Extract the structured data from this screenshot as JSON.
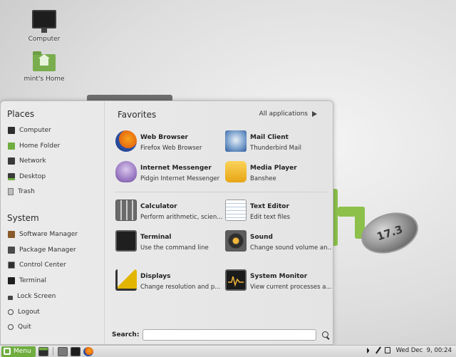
{
  "desktop": {
    "icons": [
      {
        "label": "Computer",
        "icon": "computer-icon"
      },
      {
        "label": "mint's Home",
        "icon": "home-folder-icon"
      }
    ],
    "wallpaper_badge": "17.3"
  },
  "menu": {
    "places": {
      "title": "Places",
      "items": [
        {
          "label": "Computer",
          "icon": "computer-icon"
        },
        {
          "label": "Home Folder",
          "icon": "home-folder-icon"
        },
        {
          "label": "Network",
          "icon": "network-icon"
        },
        {
          "label": "Desktop",
          "icon": "desktop-icon"
        },
        {
          "label": "Trash",
          "icon": "trash-icon"
        }
      ]
    },
    "system": {
      "title": "System",
      "items": [
        {
          "label": "Software Manager",
          "icon": "software-manager-icon"
        },
        {
          "label": "Package Manager",
          "icon": "package-manager-icon"
        },
        {
          "label": "Control Center",
          "icon": "control-center-icon"
        },
        {
          "label": "Terminal",
          "icon": "terminal-icon"
        },
        {
          "label": "Lock Screen",
          "icon": "lock-icon"
        },
        {
          "label": "Logout",
          "icon": "logout-icon"
        },
        {
          "label": "Quit",
          "icon": "quit-icon"
        }
      ]
    },
    "favorites": {
      "title": "Favorites",
      "all_applications": "All applications",
      "apps": [
        {
          "name": "Web Browser",
          "desc": "Firefox Web Browser",
          "icon": "firefox-icon"
        },
        {
          "name": "Mail Client",
          "desc": "Thunderbird Mail",
          "icon": "thunderbird-icon"
        },
        {
          "name": "Internet Messenger",
          "desc": "Pidgin Internet Messenger",
          "icon": "pidgin-icon"
        },
        {
          "name": "Media Player",
          "desc": "Banshee",
          "icon": "banshee-icon"
        },
        {
          "name": "Calculator",
          "desc": "Perform arithmetic, scien...",
          "icon": "calculator-icon"
        },
        {
          "name": "Text Editor",
          "desc": "Edit text files",
          "icon": "text-editor-icon"
        },
        {
          "name": "Terminal",
          "desc": "Use the command line",
          "icon": "terminal-icon"
        },
        {
          "name": "Sound",
          "desc": "Change sound volume an...",
          "icon": "sound-icon"
        },
        {
          "name": "Displays",
          "desc": "Change resolution and p...",
          "icon": "displays-icon"
        },
        {
          "name": "System Monitor",
          "desc": "View current processes a...",
          "icon": "system-monitor-icon"
        }
      ]
    },
    "search": {
      "label": "Search:",
      "value": "",
      "placeholder": ""
    }
  },
  "taskbar": {
    "menu_label": "Menu",
    "launchers": [
      "show-desktop-icon",
      "terminal-icon",
      "firefox-icon"
    ],
    "clock": "Wed Dec  9, 00:24"
  },
  "colors": {
    "mint_green": "#6fae3f",
    "menu_bg": "#e8e8e8",
    "taskbar_bg": "#dcdcdc"
  }
}
